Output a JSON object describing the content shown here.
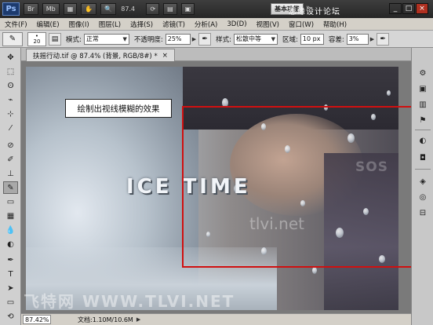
{
  "appbar": {
    "logo": "Ps",
    "buttons": [
      "Br",
      "Mb"
    ],
    "zoom": "87.4",
    "workspace_button": "基本功能",
    "workspace_more": "»",
    "watermark": "思缘设计论坛",
    "min_icon": "_",
    "max_icon": "□",
    "close_icon": "×"
  },
  "menu": [
    "文件(F)",
    "编辑(E)",
    "图像(I)",
    "图层(L)",
    "选择(S)",
    "滤镜(T)",
    "分析(A)",
    "3D(D)",
    "视图(V)",
    "窗口(W)",
    "帮助(H)"
  ],
  "options": {
    "brush_size": "20",
    "mode_label": "模式:",
    "mode_value": "正常",
    "opacity_label": "不透明度:",
    "opacity_value": "25%",
    "style_label": "样式:",
    "style_value": "松散中等",
    "area_label": "区域:",
    "area_value": "10 px",
    "tolerance_label": "容差:",
    "tolerance_value": "3%"
  },
  "document": {
    "tab_title": "扶摇行动.tif @ 87.4% (背景, RGB/8#) *",
    "tab_close": "×",
    "callout": "绘制出视线模糊的效果",
    "ice_title": "ICE TIME",
    "site_text": "tlvi.net",
    "sos_text": "SOS",
    "bottom_watermark": "飞特网 WWW.TLVI.NET"
  },
  "status": {
    "zoom": "87.42%",
    "doc_size": "文档:1.10M/10.6M"
  },
  "colors": {
    "annotation_red": "#d01010",
    "app_dark": "#2e2e2e"
  }
}
